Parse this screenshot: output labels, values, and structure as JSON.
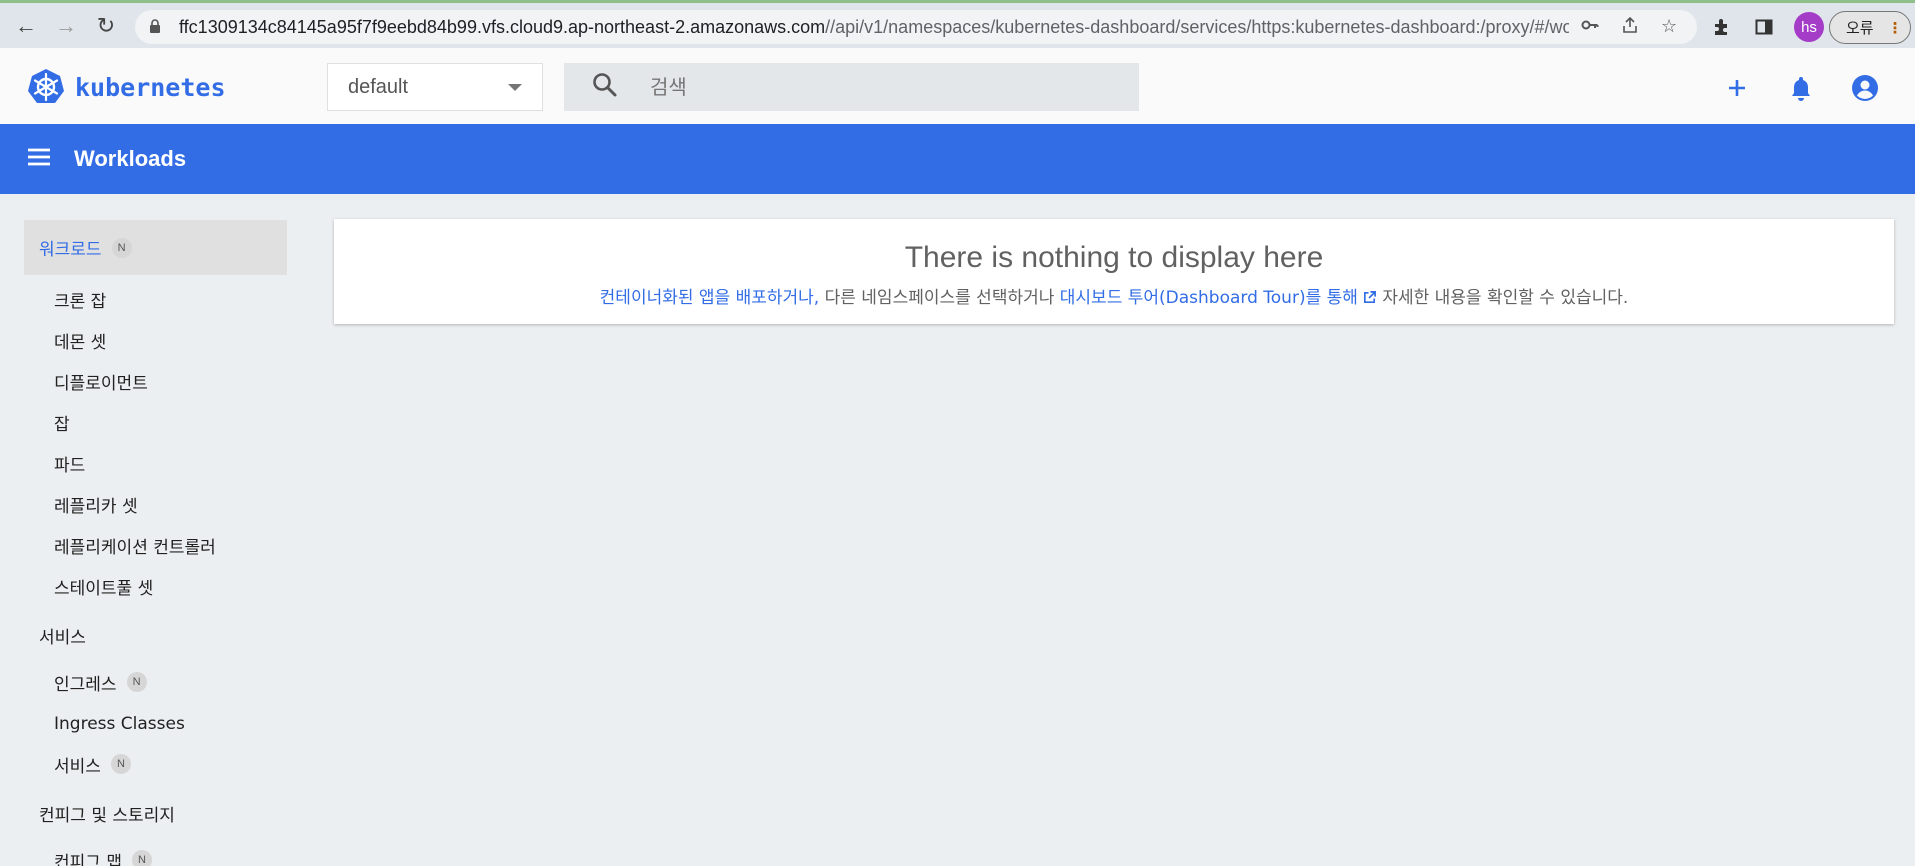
{
  "browser": {
    "url_host": "ffc1309134c84145a95f7f9eebd84b99.vfs.cloud9.ap-northeast-2.amazonaws.com",
    "url_path": "//api/v1/namespaces/kubernetes-dashboard/services/https:kubernetes-dashboard:/proxy/#/wo...",
    "profile_initials": "hs",
    "error_label": "오류"
  },
  "header": {
    "logo_text": "kubernetes",
    "namespace": "default",
    "search_placeholder": "검색",
    "brand_color": "#326de6"
  },
  "toolbar": {
    "title": "Workloads"
  },
  "sidebar": {
    "workloads": {
      "label": "워크로드",
      "badge": "N"
    },
    "workload_items": [
      {
        "label": "크론 잡"
      },
      {
        "label": "데몬 셋"
      },
      {
        "label": "디플로이먼트"
      },
      {
        "label": "잡"
      },
      {
        "label": "파드"
      },
      {
        "label": "레플리카 셋"
      },
      {
        "label": "레플리케이션 컨트롤러"
      },
      {
        "label": "스테이트풀 셋"
      }
    ],
    "services": {
      "label": "서비스"
    },
    "service_items": [
      {
        "label": "인그레스",
        "badge": "N"
      },
      {
        "label": "Ingress Classes"
      },
      {
        "label": "서비스",
        "badge": "N"
      }
    ],
    "config": {
      "label": "컨피그 및 스토리지"
    },
    "config_items": [
      {
        "label": "컨피그 맵",
        "badge": "N"
      }
    ]
  },
  "main": {
    "empty_title": "There is nothing to display here",
    "hint_link1": "컨테이너화된 앱을 배포하거나,",
    "hint_text1": " 다른 네임스페이스를 선택하거나 ",
    "hint_link2": "대시보드 투어(Dashboard Tour)를 통해",
    "hint_text2": " 자세한 내용을 확인할 수 있습니다."
  }
}
